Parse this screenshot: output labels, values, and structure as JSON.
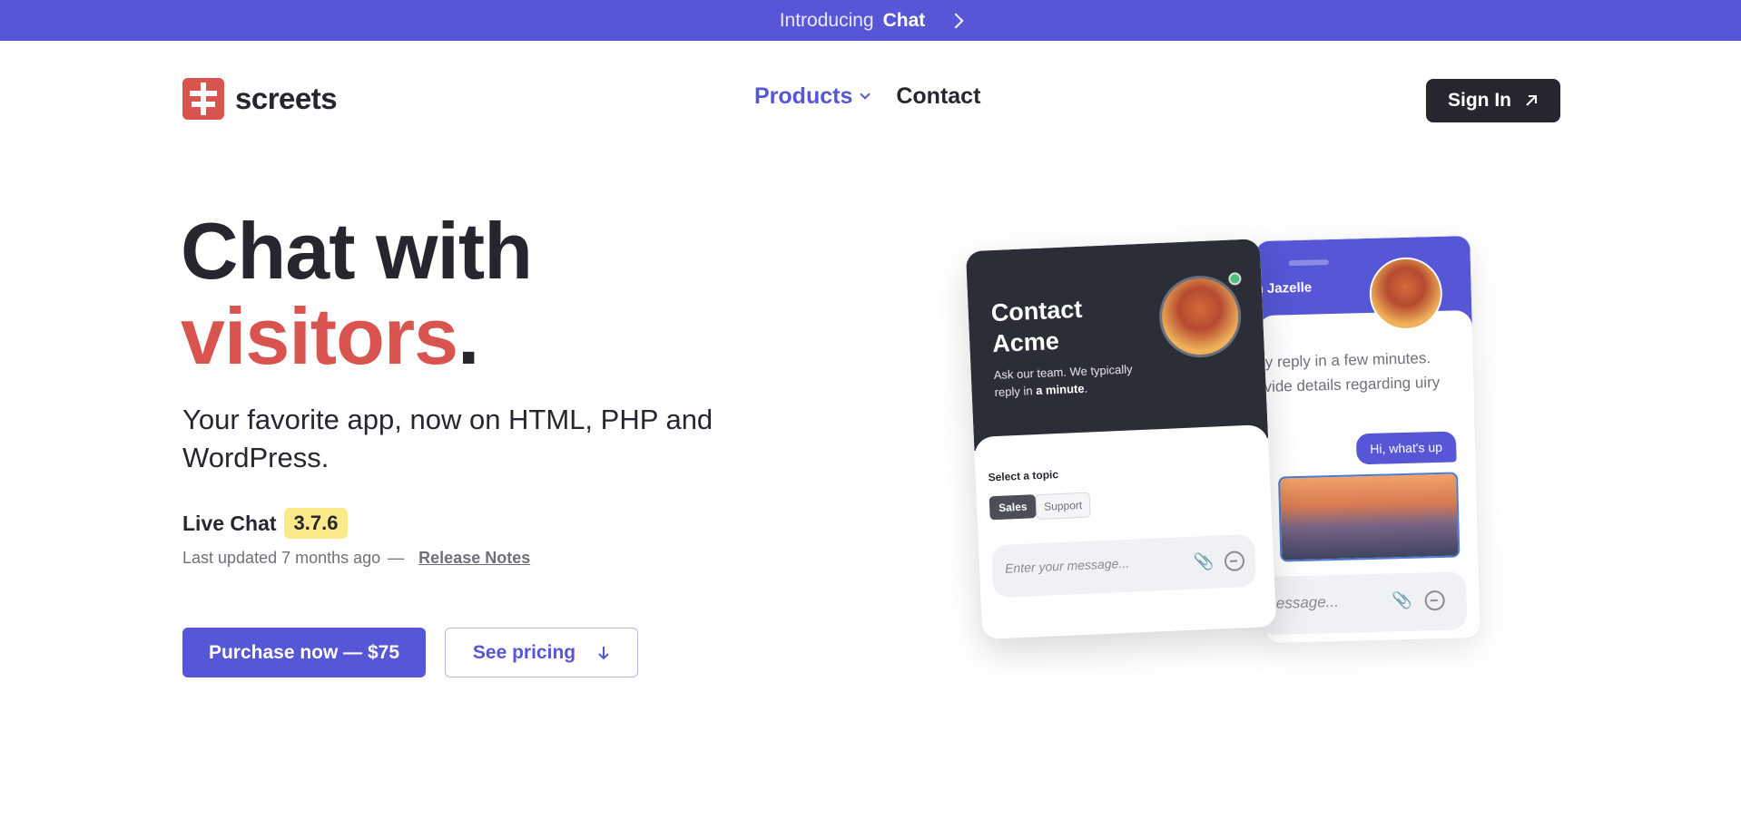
{
  "announcement": {
    "prefix": "Introducing",
    "highlight": "Chat"
  },
  "header": {
    "brand": "screets",
    "nav": {
      "products": "Products",
      "contact": "Contact"
    },
    "signin_label": "Sign In"
  },
  "hero": {
    "title_line1": "Chat with",
    "title_word_red": "visitors",
    "title_dot": ".",
    "subtitle": "Your favorite app, now on HTML, PHP and WordPress.",
    "product_name": "Live Chat",
    "version": "3.7.6",
    "updated": "Last updated 7 months ago",
    "separator": "—",
    "release_notes": "Release Notes",
    "purchase_label": "Purchase now — $75",
    "pricing_label": "See pricing"
  },
  "mockup": {
    "front": {
      "title_line1": "Contact",
      "title_line2": "Acme",
      "desc_prefix": "Ask our team. We typically reply in",
      "desc_bold": "a minute",
      "desc_suffix": ".",
      "select_topic": "Select a topic",
      "chip_sales": "Sales",
      "chip_support": "Support",
      "input_placeholder": "Enter your message..."
    },
    "back": {
      "agent_name": "n Jazelle",
      "message_text": "ally reply in a few minutes. rovide details regarding uiry",
      "bubble": "Hi, what's up",
      "input_placeholder": "message..."
    }
  },
  "colors": {
    "accent": "#5656d6",
    "red": "#d9534f",
    "dark": "#26272e",
    "version_bg": "#fbe98a"
  },
  "icons": {
    "announce_chevron": "chevron-right-icon",
    "products_dropdown": "chevron-down-icon",
    "signin_arrow": "arrow-up-right-icon",
    "pricing_arrow": "arrow-down-icon",
    "attach": "paperclip-icon",
    "send": "send-arrow-icon"
  }
}
